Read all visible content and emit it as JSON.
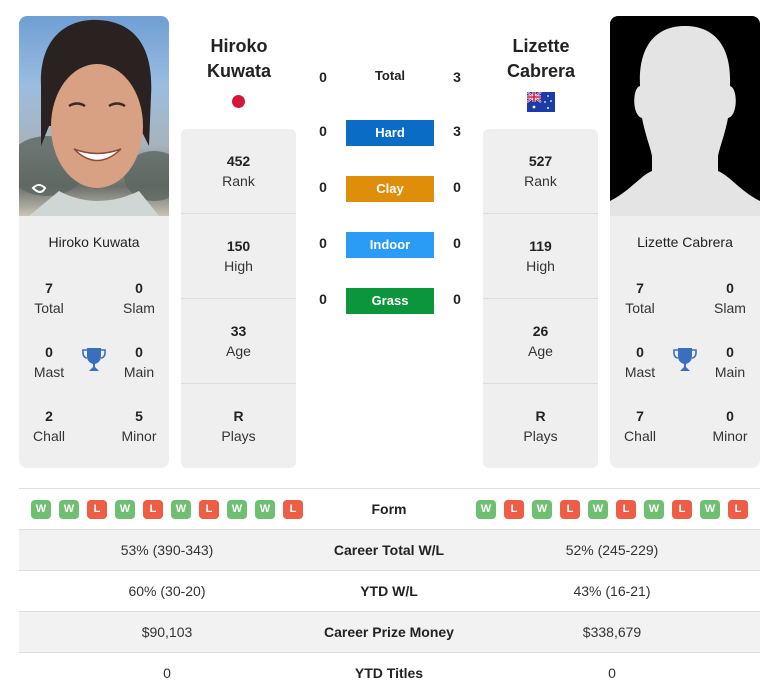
{
  "colors": {
    "hard": "#0a6cc4",
    "clay": "#df8e0a",
    "indoor": "#2b9cf5",
    "grass": "#0c963c",
    "win": "#6fbf73",
    "loss": "#ee5d45",
    "trophy": "#3a6fc0"
  },
  "player1": {
    "name_line1": "Hiroko",
    "name_line2": "Kuwata",
    "full_name": "Hiroko Kuwata",
    "flag": "japan-flag",
    "photo": "player-photo",
    "rank": {
      "value": "452",
      "label": "Rank"
    },
    "high": {
      "value": "150",
      "label": "High"
    },
    "age": {
      "value": "33",
      "label": "Age"
    },
    "plays": {
      "value": "R",
      "label": "Plays"
    },
    "titles": {
      "total": {
        "value": "7",
        "label": "Total"
      },
      "slam": {
        "value": "0",
        "label": "Slam"
      },
      "mast": {
        "value": "0",
        "label": "Mast"
      },
      "main": {
        "value": "0",
        "label": "Main"
      },
      "chall": {
        "value": "2",
        "label": "Chall"
      },
      "minor": {
        "value": "5",
        "label": "Minor"
      }
    },
    "form": [
      "W",
      "W",
      "L",
      "W",
      "L",
      "W",
      "L",
      "W",
      "W",
      "L"
    ]
  },
  "player2": {
    "name_line1": "Lizette",
    "name_line2": "Cabrera",
    "full_name": "Lizette Cabrera",
    "flag": "australia-flag",
    "photo": "silhouette-placeholder",
    "rank": {
      "value": "527",
      "label": "Rank"
    },
    "high": {
      "value": "119",
      "label": "High"
    },
    "age": {
      "value": "26",
      "label": "Age"
    },
    "plays": {
      "value": "R",
      "label": "Plays"
    },
    "titles": {
      "total": {
        "value": "7",
        "label": "Total"
      },
      "slam": {
        "value": "0",
        "label": "Slam"
      },
      "mast": {
        "value": "0",
        "label": "Mast"
      },
      "main": {
        "value": "0",
        "label": "Main"
      },
      "chall": {
        "value": "7",
        "label": "Chall"
      },
      "minor": {
        "value": "0",
        "label": "Minor"
      }
    },
    "form": [
      "W",
      "L",
      "W",
      "L",
      "W",
      "L",
      "W",
      "L",
      "W",
      "L"
    ]
  },
  "h2h": {
    "total": {
      "label": "Total",
      "p1": "0",
      "p2": "3"
    },
    "hard": {
      "label": "Hard",
      "p1": "0",
      "p2": "3"
    },
    "clay": {
      "label": "Clay",
      "p1": "0",
      "p2": "0"
    },
    "indoor": {
      "label": "Indoor",
      "p1": "0",
      "p2": "0"
    },
    "grass": {
      "label": "Grass",
      "p1": "0",
      "p2": "0"
    }
  },
  "table": {
    "form_label": "Form",
    "rows": [
      {
        "label": "Career Total W/L",
        "p1": "53% (390-343)",
        "p2": "52% (245-229)"
      },
      {
        "label": "YTD W/L",
        "p1": "60% (30-20)",
        "p2": "43% (16-21)"
      },
      {
        "label": "Career Prize Money",
        "p1": "$90,103",
        "p2": "$338,679"
      },
      {
        "label": "YTD Titles",
        "p1": "0",
        "p2": "0"
      }
    ]
  }
}
